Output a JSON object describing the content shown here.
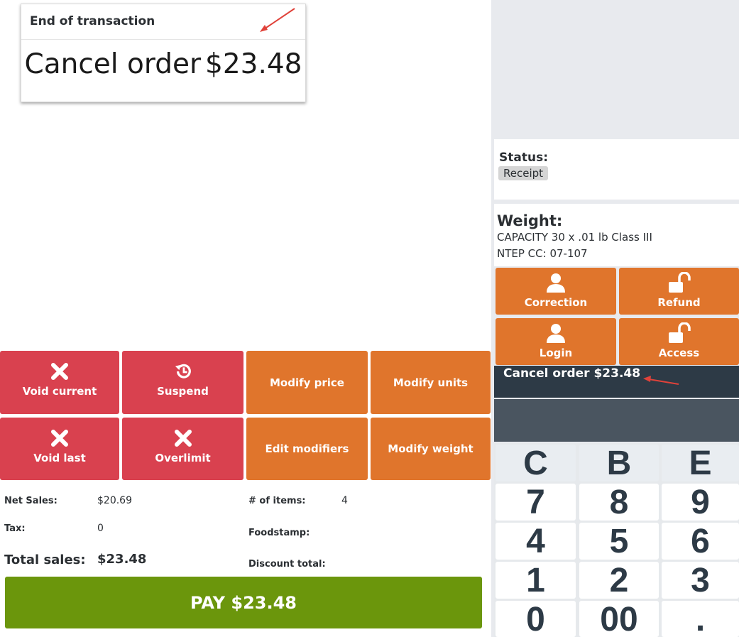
{
  "transaction_popup": {
    "title": "End of transaction",
    "label": "Cancel order",
    "amount": "$23.48"
  },
  "actions": {
    "void_current": "Void current",
    "suspend": "Suspend",
    "modify_price": "Modify price",
    "modify_units": "Modify units",
    "void_last": "Void last",
    "overlimit": "Overlimit",
    "edit_modifiers": "Edit modifiers",
    "modify_weight": "Modify weight"
  },
  "totals": {
    "net_sales_label": "Net Sales:",
    "net_sales_value": "$20.69",
    "tax_label": "Tax:",
    "tax_value": "0",
    "total_sales_label": "Total sales:",
    "total_sales_value": "$23.48",
    "items_label": "# of items:",
    "items_value": "4",
    "foodstamp_label": "Foodstamp:",
    "discount_label": "Discount total:"
  },
  "pay_button": "PAY $23.48",
  "status": {
    "label": "Status:",
    "value": "Receipt"
  },
  "weight": {
    "label": "Weight:",
    "line1": "CAPACITY 30 x .01 lb Class III",
    "line2": "NTEP CC: 07-107"
  },
  "right_buttons": {
    "correction": "Correction",
    "refund": "Refund",
    "login": "Login",
    "access": "Access"
  },
  "order_line": "Cancel order $23.48",
  "keypad": {
    "keys": [
      "C",
      "B",
      "E",
      "7",
      "8",
      "9",
      "4",
      "5",
      "6",
      "1",
      "2",
      "3",
      "0",
      "00",
      "."
    ]
  },
  "colors": {
    "red": "#d9414f",
    "orange": "#e0752c",
    "pay_green": "#6b960c",
    "dark": "#2d3a46",
    "annotation": "#e0423a"
  }
}
